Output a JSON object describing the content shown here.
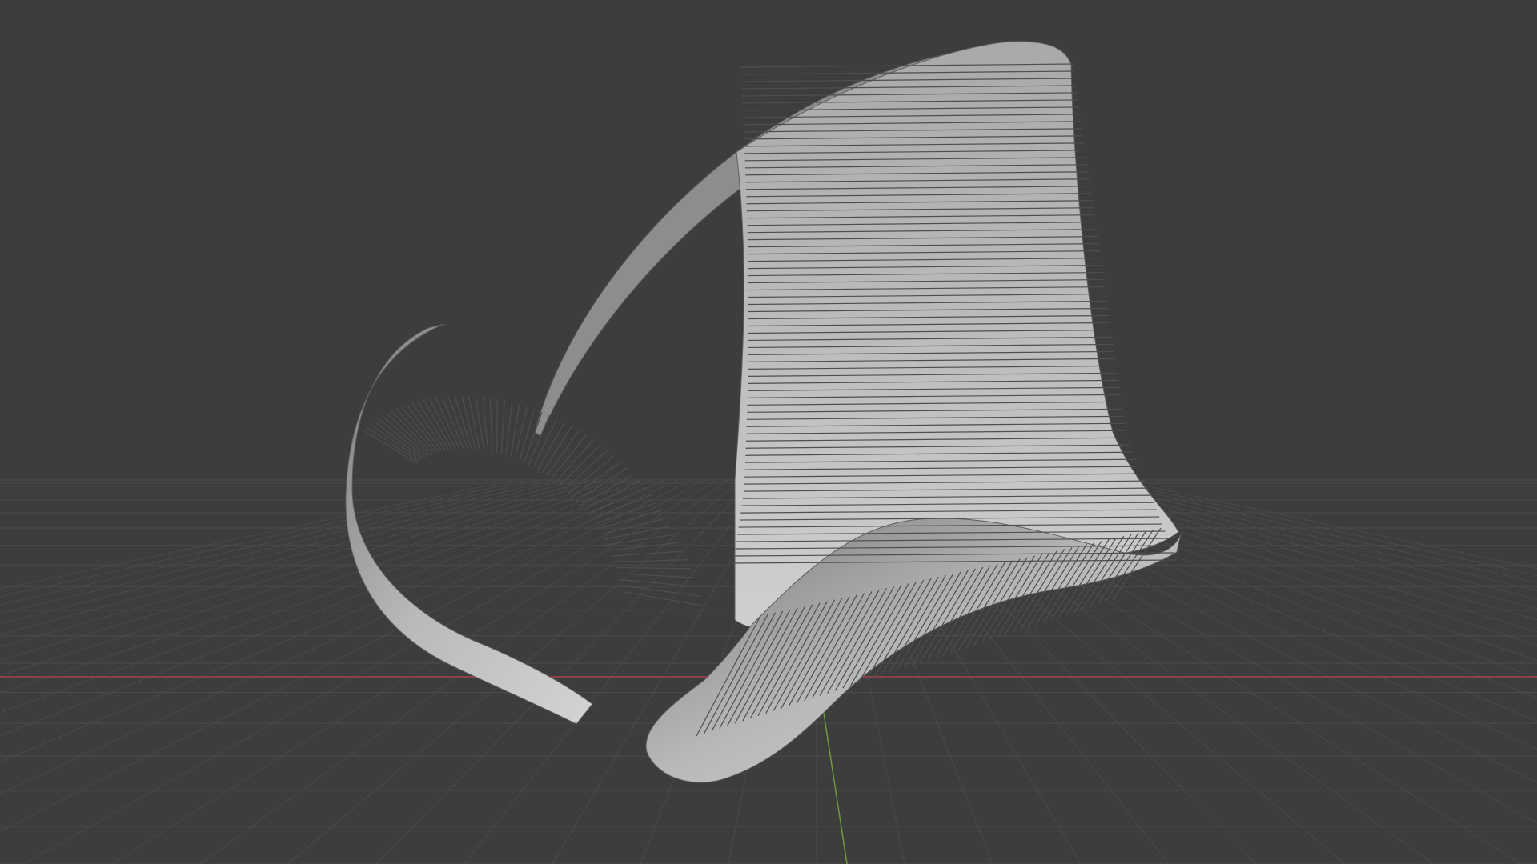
{
  "app": {
    "view": "3D Viewport"
  },
  "scene": {
    "background_color": "#3d3d3d",
    "grid_color": "#4a4a4a",
    "x_axis_color": "#b0434f",
    "y_axis_color": "#6f9b3a",
    "object": {
      "type": "twisted ribbon made of thin slats",
      "surface_color": "#c8c8c8",
      "shadow_color": "#6a6a6a"
    }
  }
}
